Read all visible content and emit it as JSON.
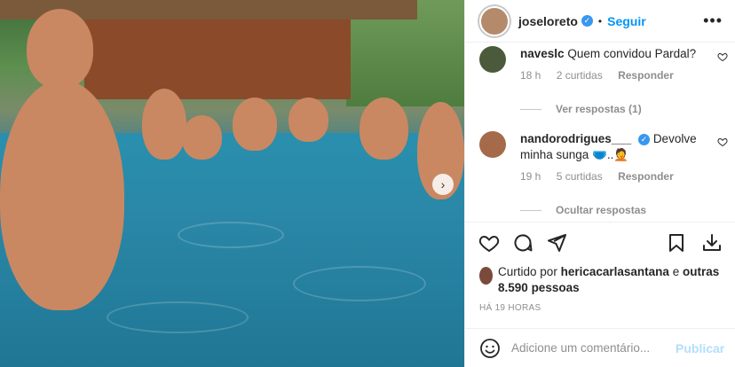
{
  "header": {
    "username": "joseloreto",
    "separator": "•",
    "follow_label": "Seguir",
    "more_label": "•••"
  },
  "comments": [
    {
      "username": "naveslc",
      "text": "Quem convidou Pardal?",
      "time": "18 h",
      "likes": "2 curtidas",
      "reply_label": "Responder",
      "thread_label": "Ver respostas (1)"
    },
    {
      "username": "nandorodrigues___",
      "verified": true,
      "text": "Devolve minha sunga 🩲..🤦",
      "time": "19 h",
      "likes": "5 curtidas",
      "reply_label": "Responder",
      "thread_label": "Ocultar respostas"
    }
  ],
  "likes": {
    "prefix": "Curtido por",
    "user": "hericacarlasantana",
    "conjunction": "e",
    "others": "outras 8.590 pessoas"
  },
  "time_ago": "HÁ 19 HORAS",
  "add_comment": {
    "placeholder": "Adicione um comentário...",
    "publish_label": "Publicar"
  },
  "icons": {
    "like": "heart-icon",
    "comment": "comment-icon",
    "share": "share-icon",
    "save": "bookmark-icon",
    "download": "download-icon",
    "emoji": "emoji-icon",
    "next": "chevron-right-icon"
  },
  "colors": {
    "accent": "#0095f6",
    "publish_disabled": "#b2dffc",
    "verified": "#3897f0",
    "muted": "#8e8e8e"
  }
}
